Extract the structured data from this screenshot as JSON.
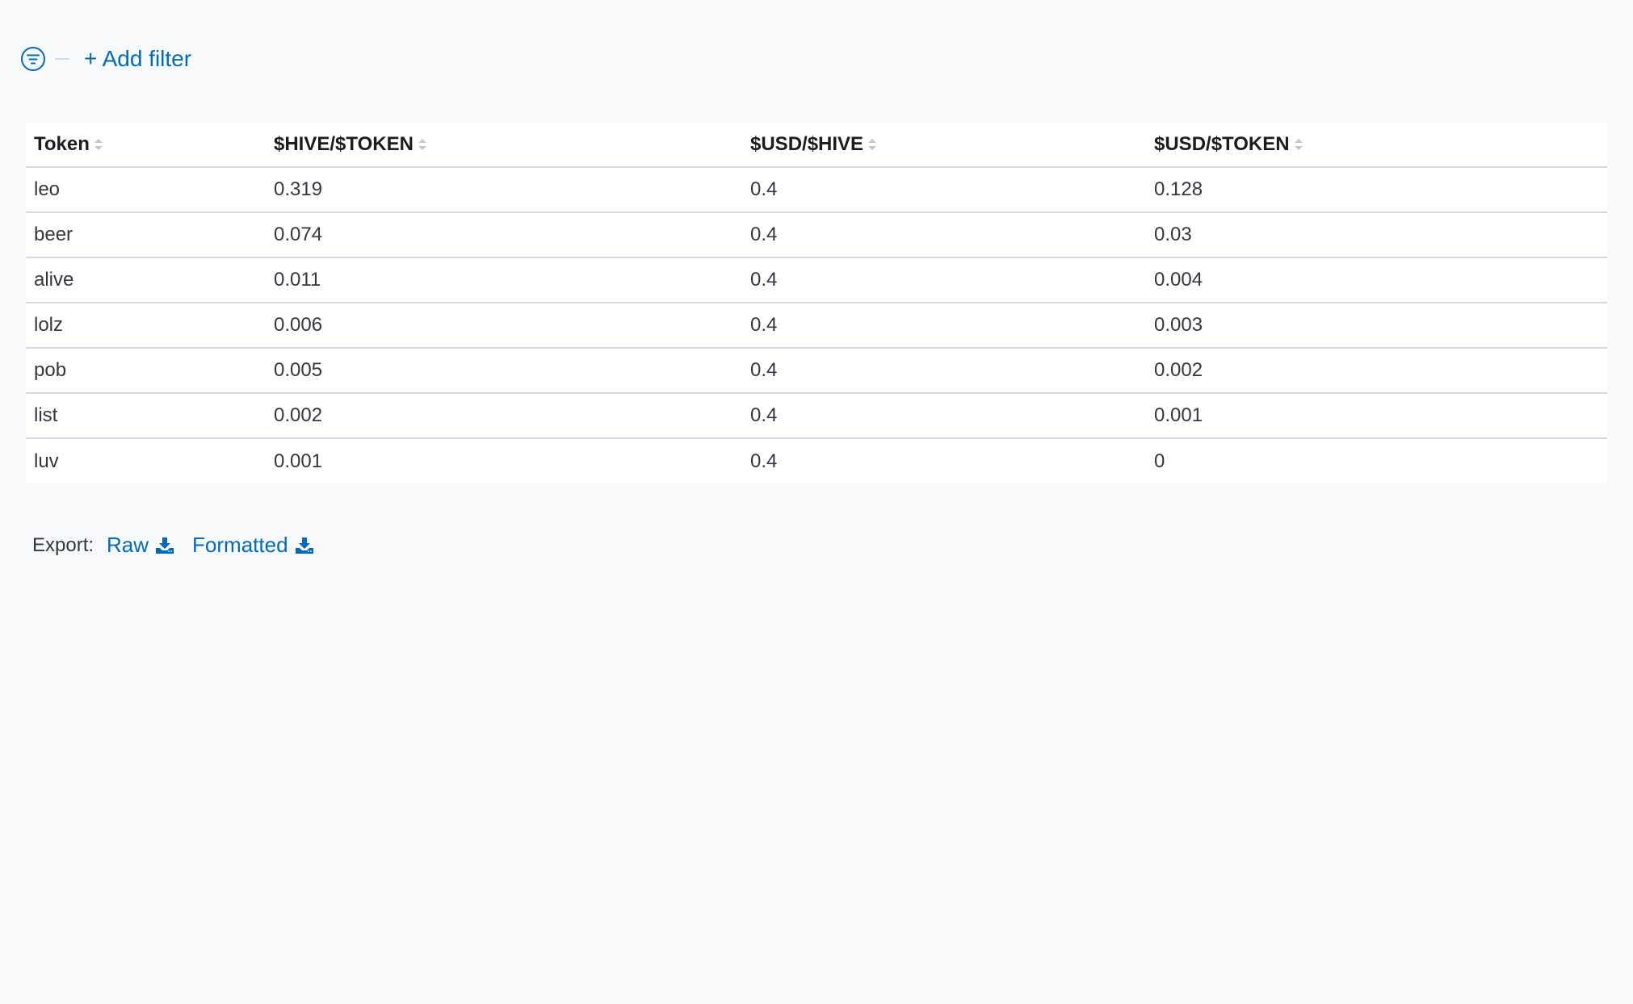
{
  "filter_bar": {
    "add_filter_label": "+ Add filter",
    "icon": "filter-icon"
  },
  "table": {
    "columns": [
      {
        "label": "Token",
        "sort_icon": "sort-icon"
      },
      {
        "label": "$HIVE/$TOKEN",
        "sort_icon": "sort-icon"
      },
      {
        "label": "$USD/$HIVE",
        "sort_icon": "sort-icon"
      },
      {
        "label": "$USD/$TOKEN",
        "sort_icon": "sort-icon"
      }
    ],
    "rows": [
      [
        "leo",
        "0.319",
        "0.4",
        "0.128"
      ],
      [
        "beer",
        "0.074",
        "0.4",
        "0.03"
      ],
      [
        "alive",
        "0.011",
        "0.4",
        "0.004"
      ],
      [
        "lolz",
        "0.006",
        "0.4",
        "0.003"
      ],
      [
        "pob",
        "0.005",
        "0.4",
        "0.002"
      ],
      [
        "list",
        "0.002",
        "0.4",
        "0.001"
      ],
      [
        "luv",
        "0.001",
        "0.4",
        "0"
      ]
    ]
  },
  "export": {
    "label": "Export:",
    "raw_label": "Raw",
    "formatted_label": "Formatted",
    "icon": "download-icon"
  },
  "colors": {
    "accent": "#006bb8",
    "background": "#f8f9fb",
    "border": "#d3dae6",
    "text": "#343741"
  }
}
